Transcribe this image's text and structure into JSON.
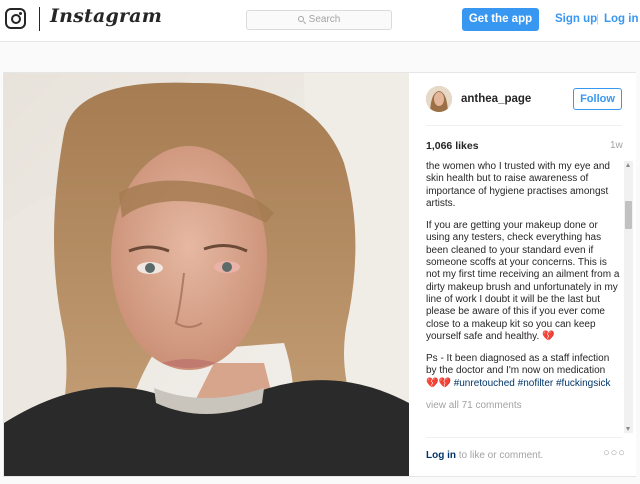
{
  "header": {
    "wordmark": "Instagram",
    "search_placeholder": "Search",
    "get_app_label": "Get the app",
    "sign_up_label": "Sign up",
    "separator": "|",
    "log_in_label": "Log in",
    "accent_color": "#3897f0"
  },
  "post": {
    "username": "anthea_page",
    "follow_label": "Follow",
    "likes": "1,066 likes",
    "time_ago": "1w",
    "caption_paragraphs": [
      "the women who I trusted with my eye and skin health but to raise awareness of importance of hygiene practises amongst artists.",
      "If you are getting your makeup done or using any testers, check everything has been cleaned to your standard even if someone scoffs at your concerns. This is not my first time receiving an ailment from a dirty makeup brush and unfortunately in my line of work I doubt it will be the last but please be aware of this if you ever come close to a makeup kit so you can keep yourself safe and healthy. 💔"
    ],
    "ps_text": "Ps - It been diagnosed as a staff infection by the doctor and I'm now on medication 💔💔",
    "hashtags": [
      "#unretouched",
      "#nofilter",
      "#fuckingsick"
    ],
    "view_comments": "view all 71 comments",
    "login_link": "Log in",
    "login_suffix": " to like or comment.",
    "more_icon": "more-options-icon"
  }
}
